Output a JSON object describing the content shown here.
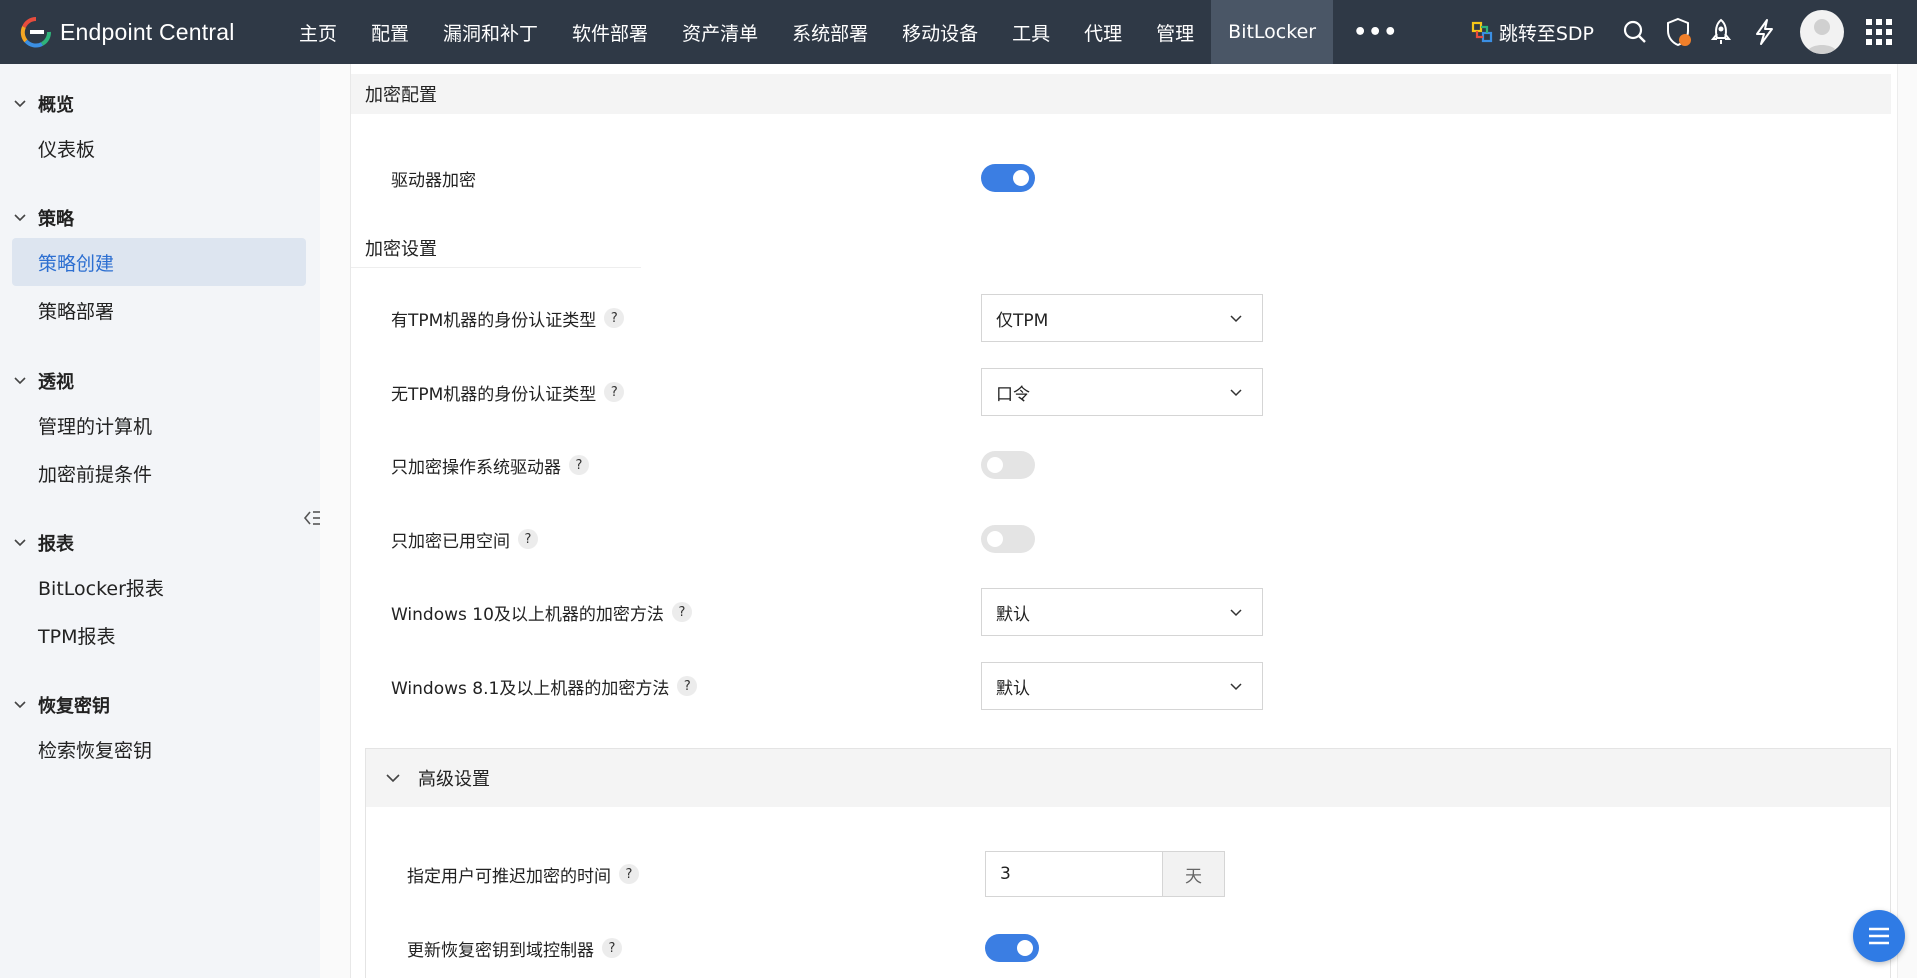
{
  "brand": {
    "name": "Endpoint Central"
  },
  "nav": {
    "items": [
      {
        "label": "主页"
      },
      {
        "label": "配置"
      },
      {
        "label": "漏洞和补丁"
      },
      {
        "label": "软件部署"
      },
      {
        "label": "资产清单"
      },
      {
        "label": "系统部署"
      },
      {
        "label": "移动设备"
      },
      {
        "label": "工具"
      },
      {
        "label": "代理"
      },
      {
        "label": "管理"
      },
      {
        "label": "BitLocker"
      }
    ],
    "active": "BitLocker",
    "more": "•••"
  },
  "topright": {
    "sdp_label": "跳转至SDP"
  },
  "sidebar": {
    "groups": [
      {
        "title": "概览",
        "items": [
          {
            "label": "仪表板"
          }
        ]
      },
      {
        "title": "策略",
        "items": [
          {
            "label": "策略创建"
          },
          {
            "label": "策略部署"
          }
        ]
      },
      {
        "title": "透视",
        "items": [
          {
            "label": "管理的计算机"
          },
          {
            "label": "加密前提条件"
          }
        ]
      },
      {
        "title": "报表",
        "items": [
          {
            "label": "BitLocker报表"
          },
          {
            "label": "TPM报表"
          }
        ]
      },
      {
        "title": "恢复密钥",
        "items": [
          {
            "label": "检索恢复密钥"
          }
        ]
      }
    ],
    "active_item": "策略创建"
  },
  "main": {
    "encryption_config": {
      "title": "加密配置",
      "drive_encryption": {
        "label": "驱动器加密",
        "on": true
      }
    },
    "encryption_settings": {
      "title": "加密设置",
      "tpm_auth": {
        "label": "有TPM机器的身份认证类型",
        "value": "仅TPM"
      },
      "no_tpm_auth": {
        "label": "无TPM机器的身份认证类型",
        "value": "口令"
      },
      "os_drive_only": {
        "label": "只加密操作系统驱动器",
        "on": false
      },
      "used_space_only": {
        "label": "只加密已用空间",
        "on": false
      },
      "win10_method": {
        "label": "Windows 10及以上机器的加密方法",
        "value": "默认"
      },
      "win81_method": {
        "label": "Windows 8.1及以上机器的加密方法",
        "value": "默认"
      }
    },
    "advanced": {
      "title": "高级设置",
      "defer_time": {
        "label": "指定用户可推迟加密的时间",
        "value": "3",
        "unit": "天"
      },
      "update_recovery_key": {
        "label": "更新恢复密钥到域控制器",
        "on": true
      }
    },
    "help_glyph": "?"
  },
  "colors": {
    "topbar": "#2f3946",
    "accent": "#3b7ee3",
    "sidebar_bg": "#f3f5f8",
    "sidebar_active_bg": "#dde5f0",
    "sidebar_active_text": "#2d6fd1"
  }
}
